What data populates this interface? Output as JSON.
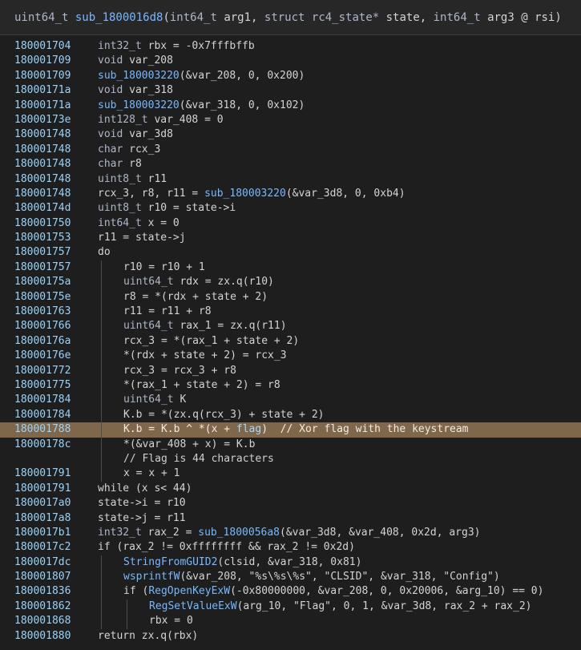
{
  "header": {
    "parts": [
      {
        "text": "uint64_t ",
        "cls": "tok-type"
      },
      {
        "text": "sub_1800016d8",
        "cls": "tok-func"
      },
      {
        "text": "(",
        "cls": "tok-default"
      },
      {
        "text": "int64_t ",
        "cls": "tok-type"
      },
      {
        "text": "arg1, ",
        "cls": "tok-default"
      },
      {
        "text": "struct rc4_state* ",
        "cls": "tok-type"
      },
      {
        "text": "state, ",
        "cls": "tok-default"
      },
      {
        "text": "int64_t ",
        "cls": "tok-type"
      },
      {
        "text": "arg3 @ rsi)",
        "cls": "tok-default"
      }
    ]
  },
  "colors": {
    "background": "#1e1e1e",
    "address": "#9ad2f8",
    "function": "#79b8ff",
    "highlight": "#7f674b"
  },
  "lines": [
    {
      "addr": "180001704",
      "indent": 0,
      "text": "int32_t rbx = -0x7fffbffb"
    },
    {
      "addr": "180001709",
      "indent": 0,
      "text": "void var_208"
    },
    {
      "addr": "180001709",
      "indent": 0,
      "text": "sub_180003220(&var_208, 0, 0x200)"
    },
    {
      "addr": "18000171a",
      "indent": 0,
      "text": "void var_318"
    },
    {
      "addr": "18000171a",
      "indent": 0,
      "text": "sub_180003220(&var_318, 0, 0x102)"
    },
    {
      "addr": "18000173e",
      "indent": 0,
      "text": "int128_t var_408 = 0"
    },
    {
      "addr": "180001748",
      "indent": 0,
      "text": "void var_3d8"
    },
    {
      "addr": "180001748",
      "indent": 0,
      "text": "char rcx_3"
    },
    {
      "addr": "180001748",
      "indent": 0,
      "text": "char r8"
    },
    {
      "addr": "180001748",
      "indent": 0,
      "text": "uint8_t r11"
    },
    {
      "addr": "180001748",
      "indent": 0,
      "text": "rcx_3, r8, r11 = sub_180003220(&var_3d8, 0, 0xb4)"
    },
    {
      "addr": "18000174d",
      "indent": 0,
      "text": "uint8_t r10 = state->i"
    },
    {
      "addr": "180001750",
      "indent": 0,
      "text": "int64_t x = 0"
    },
    {
      "addr": "180001753",
      "indent": 0,
      "text": "r11 = state->j"
    },
    {
      "addr": "180001757",
      "indent": 0,
      "text": "do"
    },
    {
      "addr": "180001757",
      "indent": 1,
      "text": "r10 = r10 + 1"
    },
    {
      "addr": "18000175a",
      "indent": 1,
      "text": "uint64_t rdx = zx.q(r10)"
    },
    {
      "addr": "18000175e",
      "indent": 1,
      "text": "r8 = *(rdx + state + 2)"
    },
    {
      "addr": "180001763",
      "indent": 1,
      "text": "r11 = r11 + r8"
    },
    {
      "addr": "180001766",
      "indent": 1,
      "text": "uint64_t rax_1 = zx.q(r11)"
    },
    {
      "addr": "18000176a",
      "indent": 1,
      "text": "rcx_3 = *(rax_1 + state + 2)"
    },
    {
      "addr": "18000176e",
      "indent": 1,
      "text": "*(rdx + state + 2) = rcx_3"
    },
    {
      "addr": "180001772",
      "indent": 1,
      "text": "rcx_3 = rcx_3 + r8"
    },
    {
      "addr": "180001775",
      "indent": 1,
      "text": "*(rax_1 + state + 2) = r8"
    },
    {
      "addr": "180001784",
      "indent": 1,
      "text": "uint64_t K"
    },
    {
      "addr": "180001784",
      "indent": 1,
      "text": "K.b = *(zx.q(rcx_3) + state + 2)"
    },
    {
      "addr": "180001788",
      "indent": 1,
      "text": "K.b = K.b ^ *(x + flag)  // Xor flag with the keystream",
      "highlight": true
    },
    {
      "addr": "18000178c",
      "indent": 1,
      "text": "*(&var_408 + x) = K.b"
    },
    {
      "addr": "",
      "indent": 1,
      "text": "// Flag is 44 characters"
    },
    {
      "addr": "180001791",
      "indent": 1,
      "text": "x = x + 1"
    },
    {
      "addr": "180001791",
      "indent": 0,
      "text": "while (x s< 44)"
    },
    {
      "addr": "1800017a0",
      "indent": 0,
      "text": "state->i = r10"
    },
    {
      "addr": "1800017a8",
      "indent": 0,
      "text": "state->j = r11"
    },
    {
      "addr": "1800017b1",
      "indent": 0,
      "text": "int32_t rax_2 = sub_1800056a8(&var_3d8, &var_408, 0x2d, arg3)"
    },
    {
      "addr": "1800017c2",
      "indent": 0,
      "text": "if (rax_2 != 0xffffffff && rax_2 != 0x2d)"
    },
    {
      "addr": "1800017dc",
      "indent": 1,
      "text": "StringFromGUID2(clsid, &var_318, 0x81)"
    },
    {
      "addr": "180001807",
      "indent": 1,
      "text": "wsprintfW(&var_208, \"%s\\%s\\%s\", \"CLSID\", &var_318, \"Config\")"
    },
    {
      "addr": "180001836",
      "indent": 1,
      "text": "if (RegOpenKeyExW(-0x80000000, &var_208, 0, 0x20006, &arg_10) == 0)"
    },
    {
      "addr": "180001862",
      "indent": 2,
      "text": "RegSetValueExW(arg_10, \"Flag\", 0, 1, &var_3d8, rax_2 + rax_2)"
    },
    {
      "addr": "180001868",
      "indent": 2,
      "text": "rbx = 0"
    },
    {
      "addr": "180001880",
      "indent": 0,
      "text": "return zx.q(rbx)"
    }
  ]
}
